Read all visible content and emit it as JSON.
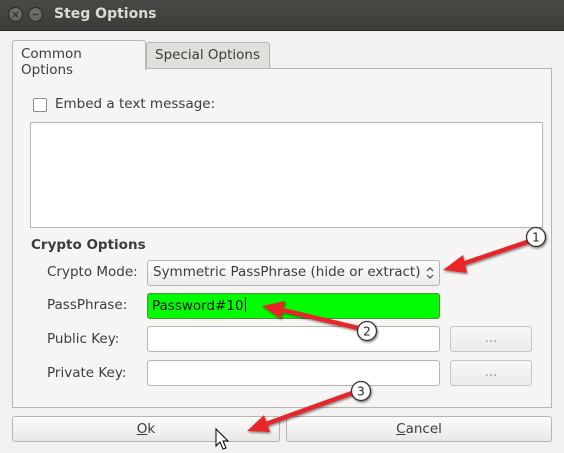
{
  "window": {
    "title": "Steg Options"
  },
  "tabs": [
    {
      "label": "Common Options",
      "active": true
    },
    {
      "label": "Special Options",
      "active": false
    }
  ],
  "embed": {
    "checkbox_label": "Embed a text message:",
    "checked": false,
    "message": ""
  },
  "crypto": {
    "section_title": "Crypto Options",
    "mode_label": "Crypto Mode:",
    "mode_value": "Symmetric PassPhrase (hide or extract)",
    "passphrase_label": "PassPhrase:",
    "passphrase_value": "Password#10",
    "passphrase_highlight": "#00ff00",
    "public_key_label": "Public Key:",
    "public_key_value": "",
    "private_key_label": "Private Key:",
    "private_key_value": "",
    "browse_label": "..."
  },
  "buttons": {
    "ok_accel": "O",
    "ok_rest": "k",
    "cancel_accel": "C",
    "cancel_rest": "ancel"
  },
  "annotations": {
    "badge_1": "1",
    "badge_2": "2",
    "badge_3": "3",
    "arrow_color": "#e8262a"
  }
}
